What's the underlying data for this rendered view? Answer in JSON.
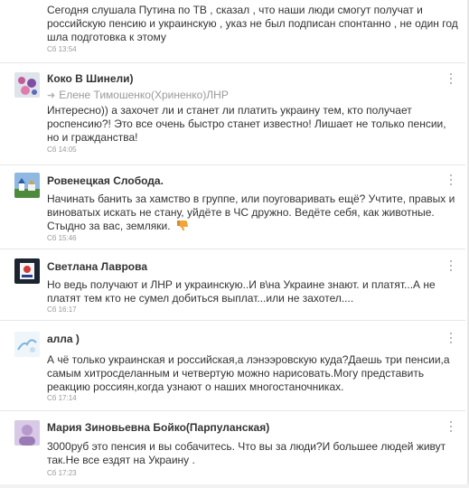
{
  "comments": [
    {
      "author": "",
      "text": "Сегодня слушала Путина по ТВ , сказал , что наши люди смогут получат и российскую пенсию и украинскую , указ не был подписан спонтанно , не один год шла подготовка к этому",
      "time": "Сб 13:54"
    },
    {
      "author": "Коко В Шинели)",
      "reply_to": "Елене Тимошенко(Хриненко)ЛНР",
      "text": "Интересно)) а захочет ли и станет ли платить украину тем, кто получает роспенсию?! Это все очень быстро станет известно! Лишает не только пенсии, но и гражданства!",
      "time": "Сб 14:05"
    },
    {
      "author": "Ровенецкая Слобода.",
      "text": "Начинать банить за хамство в группе, или поуговаривать ещё? Учтите, правых и виноватых искать не стану, уйдёте в ЧС дружно. Ведёте себя, как животные. Стыдно за вас, земляки.",
      "time": "Сб 15:46"
    },
    {
      "author": "Светлана Лаврова",
      "text": "Но ведь получают и ЛНР и украинскую..И в\\на Украине знают. и платят...А не платят тем кто не сумел добиться выплат...или не захотел....",
      "time": "Сб 16:17"
    },
    {
      "author": "алла )",
      "text": "А чё только украинская и российская,а лэнээровскую куда?Даешь три пенсии,а самым хитросделанным и четвертую можно нарисовать.Могу представить реакцию россиян,когда узнают о наших многостаночниках.",
      "time": "Сб 17:14"
    },
    {
      "author": "Мария Зиновьевна Бойко(Парпуланская)",
      "text": "3000руб это пенсия и вы собачитесь. Что вы за люди?И большее людей живут так.Не все ездят на Украину .",
      "time": "Сб 17:23"
    }
  ],
  "colors": {
    "text": "#333333",
    "meta": "#999999",
    "divider": "#e6e6e6"
  },
  "icons": [
    "arrow-right-icon",
    "more-vertical-icon",
    "thumbs-down-icon"
  ]
}
